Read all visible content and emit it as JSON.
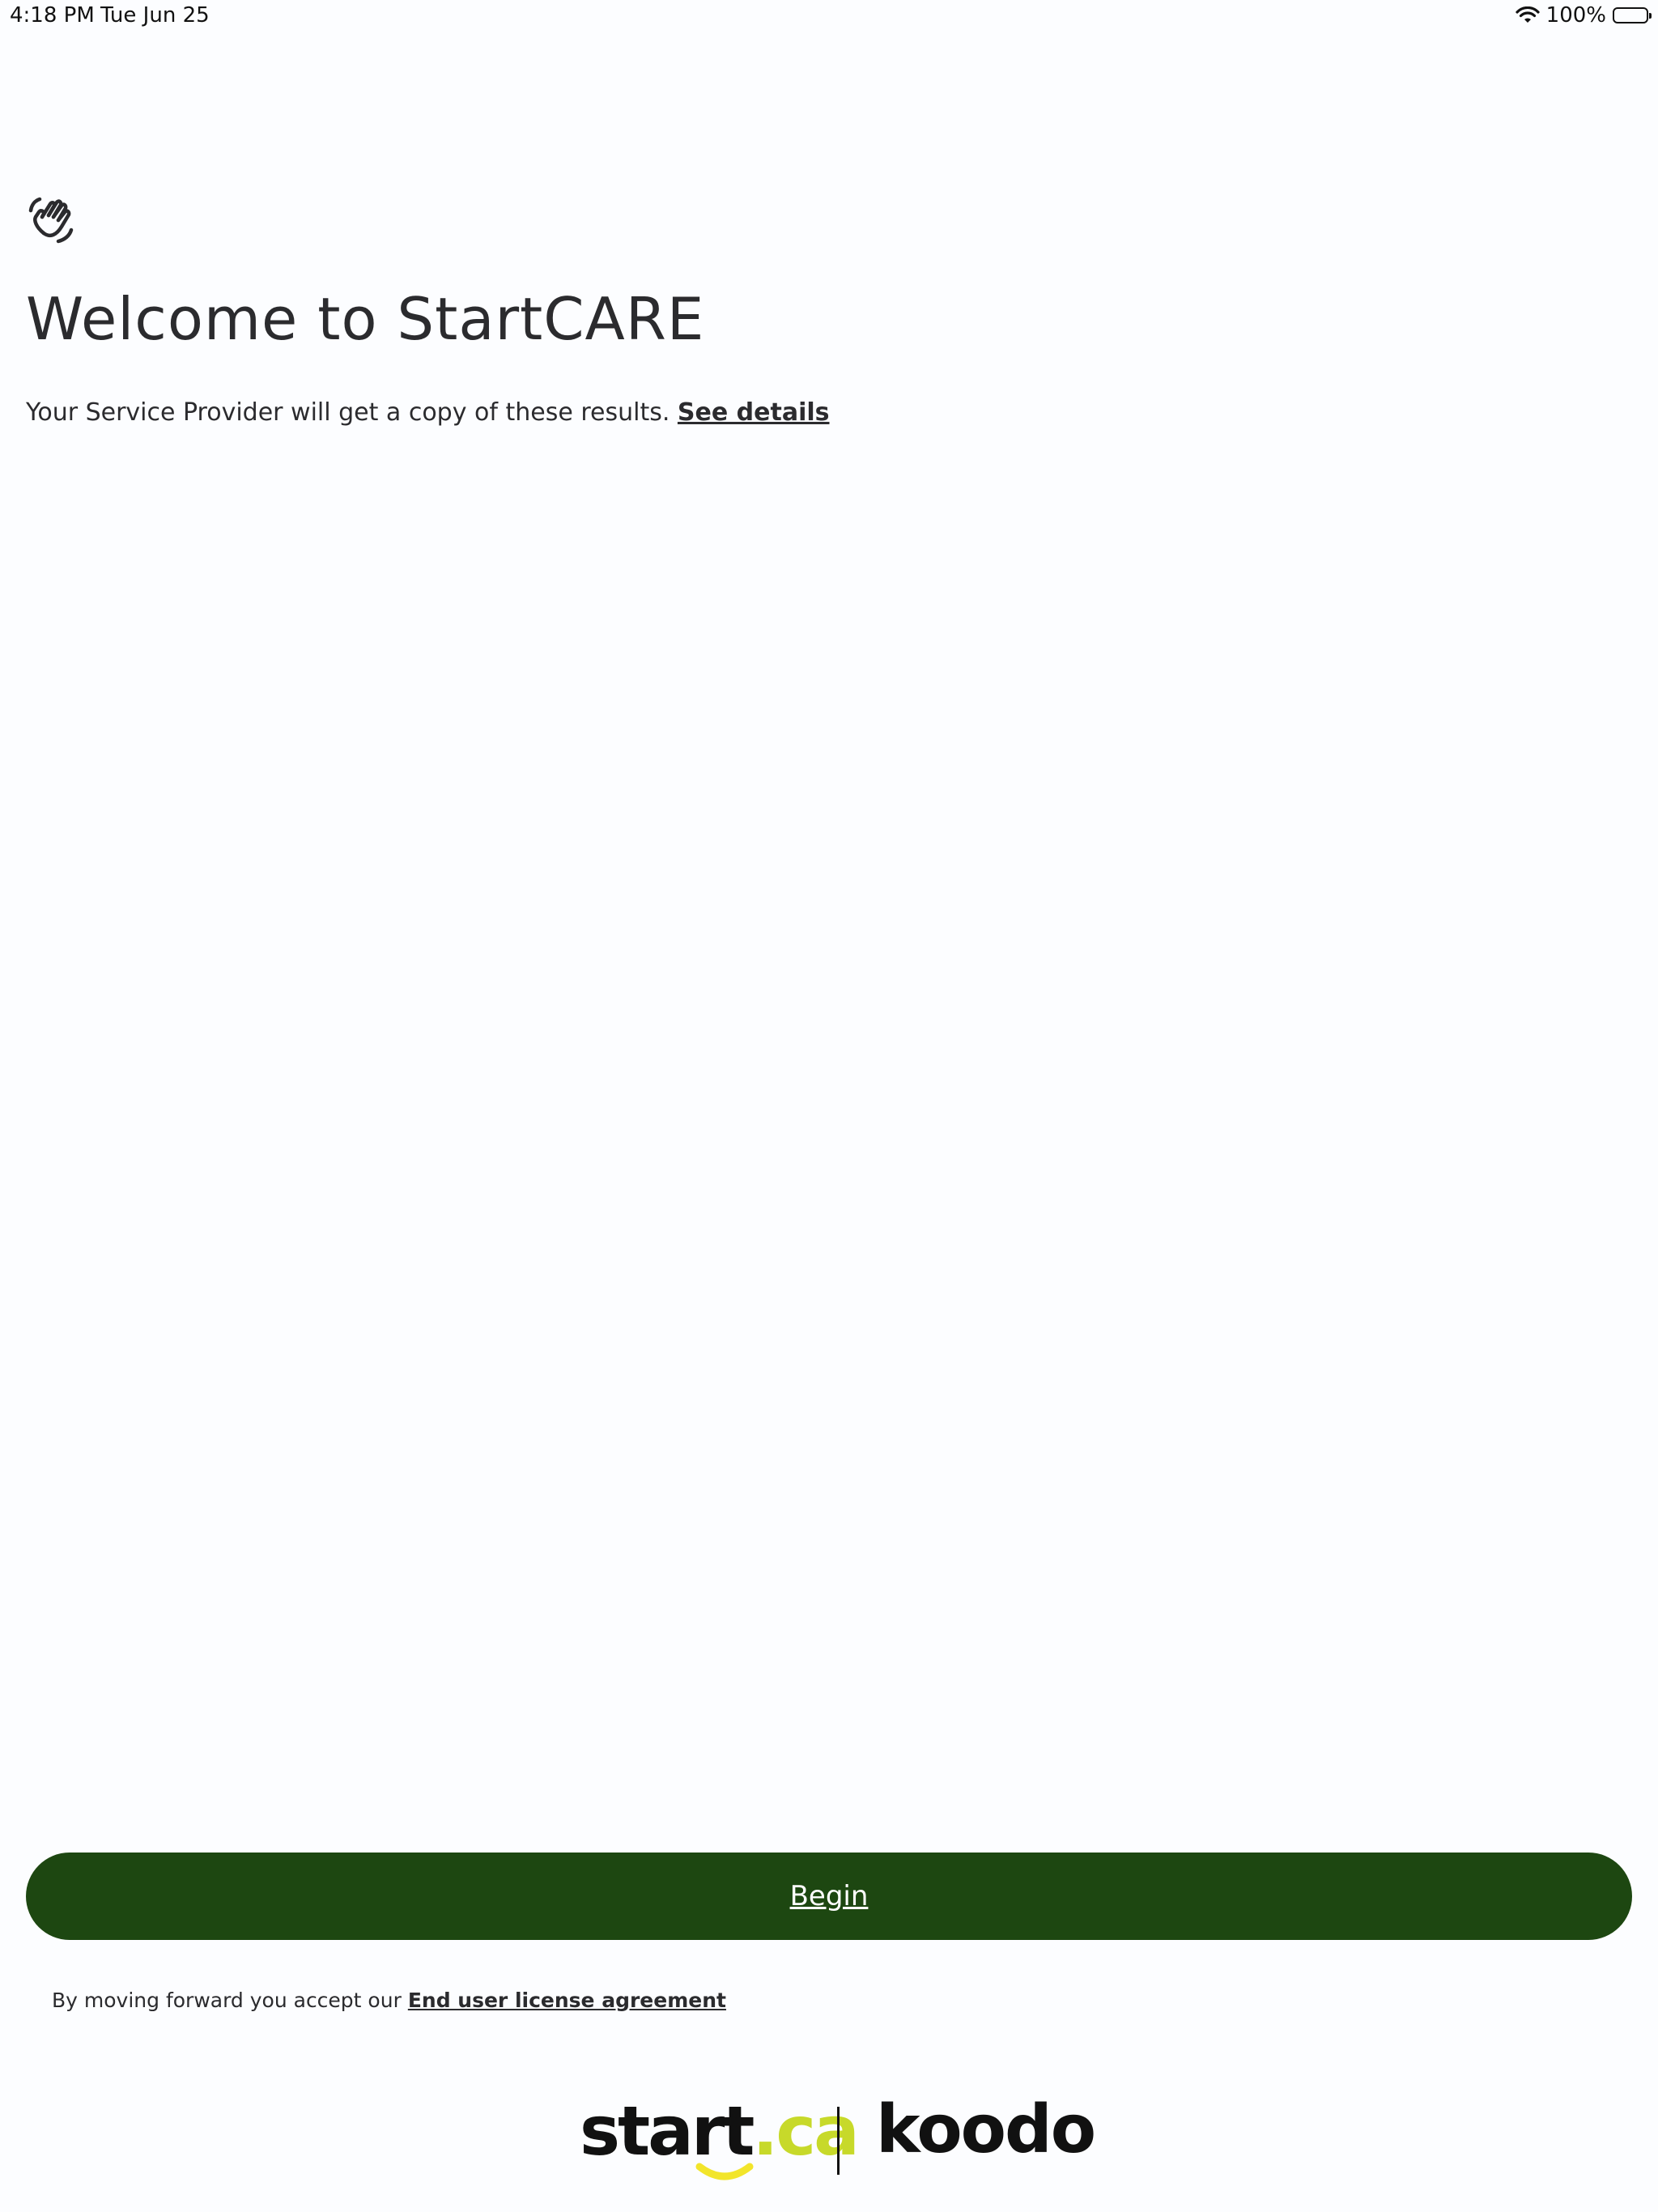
{
  "status_bar": {
    "time": "4:18 PM",
    "date": "Tue Jun 25",
    "battery": "100%",
    "icons": [
      "wifi-icon",
      "battery-icon"
    ]
  },
  "header": {
    "icon": "waving-hand-icon",
    "title": "Welcome to StartCARE",
    "subtitle": "Your Service Provider will get a copy of these results.",
    "details_link": "See details"
  },
  "actions": {
    "begin_label": "Begin",
    "begin_color": "#1d4711"
  },
  "footer": {
    "eula_text": "By moving forward you accept our",
    "eula_link": "End user license agreement",
    "logo_start": "start",
    "logo_start_suffix": ".ca",
    "logo_koodo": "koodo",
    "accent_color": "#c7d92a"
  }
}
